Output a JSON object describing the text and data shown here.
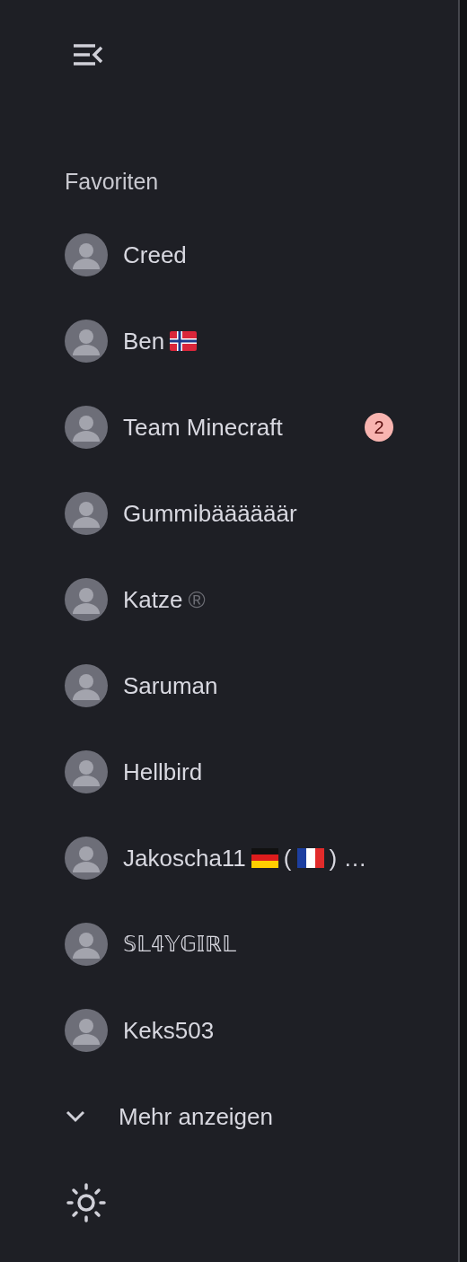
{
  "section_title": "Favoriten",
  "contacts": [
    {
      "parts": [
        {
          "kind": "text",
          "text": "Creed"
        }
      ]
    },
    {
      "parts": [
        {
          "kind": "text",
          "text": "Ben"
        },
        {
          "kind": "norway_flag"
        }
      ]
    },
    {
      "parts": [
        {
          "kind": "text",
          "text": "Team Minecraft"
        }
      ],
      "badge": "2"
    },
    {
      "parts": [
        {
          "kind": "text",
          "text": "Gummibäääääär"
        }
      ]
    },
    {
      "parts": [
        {
          "kind": "text",
          "text": "Katze"
        },
        {
          "kind": "symbol",
          "text": "®"
        }
      ]
    },
    {
      "parts": [
        {
          "kind": "text",
          "text": "Saruman"
        }
      ]
    },
    {
      "parts": [
        {
          "kind": "text",
          "text": "Hellbird"
        }
      ]
    },
    {
      "parts": [
        {
          "kind": "text",
          "text": "Jakoscha11"
        },
        {
          "kind": "germany_flag"
        },
        {
          "kind": "text",
          "text": "("
        },
        {
          "kind": "france_flag"
        },
        {
          "kind": "text",
          "text": ") …"
        }
      ]
    },
    {
      "parts": [
        {
          "kind": "text",
          "text": "𝕊𝕃𝟜𝕐𝔾𝕀ℝ𝕃"
        }
      ]
    },
    {
      "parts": [
        {
          "kind": "text",
          "text": "Keks503"
        }
      ]
    }
  ],
  "show_more": "Mehr anzeigen"
}
